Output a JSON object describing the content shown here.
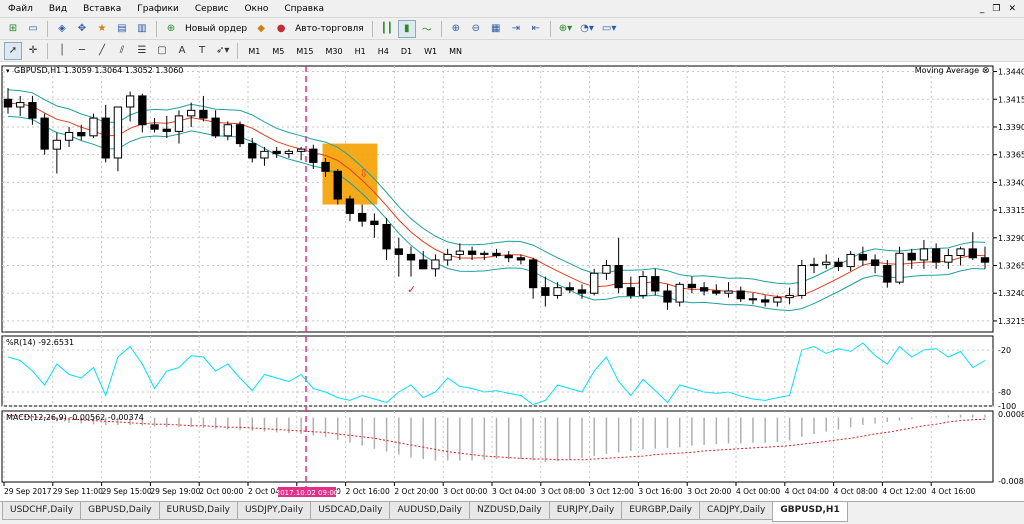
{
  "menu": [
    "Файл",
    "Вид",
    "Вставка",
    "Графики",
    "Сервис",
    "Окно",
    "Справка"
  ],
  "toolbar": {
    "new_order": "Новый ордер",
    "auto_trading": "Авто-торговля",
    "timeframes": [
      "M1",
      "M5",
      "M15",
      "M30",
      "H1",
      "H4",
      "D1",
      "W1",
      "MN"
    ],
    "active_timeframe": "H1"
  },
  "chart": {
    "header": "GBPUSD,H1  1.3059 1.3064 1.3052 1.3060",
    "indicator_label": "Moving Average",
    "price_ticks": [
      "1.3440",
      "1.3415",
      "1.3390",
      "1.3365",
      "1.3340",
      "1.3315",
      "1.3290",
      "1.3265",
      "1.3240",
      "1.3215"
    ],
    "wpr_label": "%R(14) -92.6531",
    "wpr_ticks": [
      "-20",
      "-80",
      "-100"
    ],
    "macd_label": "MACD(12,26,9) -0.00562 -0.00374",
    "macd_ticks": [
      "0.00089",
      "-0.00870"
    ],
    "time_ticks": [
      "29 Sep 2017",
      "29 Sep 11:00",
      "29 Sep 15:00",
      "29 Sep 19:00",
      "2 Oct 00:00",
      "2 Oct 04:00",
      "2 Oct 12:00",
      "2 Oct 16:00",
      "2 Oct 20:00",
      "3 Oct 00:00",
      "3 Oct 04:00",
      "3 Oct 08:00",
      "3 Oct 12:00",
      "3 Oct 16:00",
      "3 Oct 20:00",
      "4 Oct 00:00",
      "4 Oct 04:00",
      "4 Oct 08:00",
      "4 Oct 12:00",
      "4 Oct 16:00"
    ],
    "cursor_time": "2017.10.02 09:00",
    "colors": {
      "bull": "#ffffff",
      "bear": "#000000",
      "ma_channel": "#20a0a0",
      "ma_mid": "#e04020",
      "wpr": "#00e0ff",
      "macd_signal": "#e02020",
      "highlight": "#f5a000",
      "crosshair": "#e0308a"
    }
  },
  "chart_data": {
    "type": "candlestick",
    "symbol": "GBPUSD",
    "timeframe": "H1",
    "ylim": [
      1.3205,
      1.3445
    ],
    "candles": [
      [
        1.3415,
        1.3425,
        1.3402,
        1.3408
      ],
      [
        1.3408,
        1.3418,
        1.34,
        1.3412
      ],
      [
        1.3412,
        1.3418,
        1.3392,
        1.3398
      ],
      [
        1.3398,
        1.3402,
        1.3365,
        1.337
      ],
      [
        1.337,
        1.3385,
        1.3348,
        1.3378
      ],
      [
        1.3378,
        1.339,
        1.3372,
        1.3385
      ],
      [
        1.3385,
        1.3392,
        1.3378,
        1.3382
      ],
      [
        1.3382,
        1.3402,
        1.338,
        1.3398
      ],
      [
        1.3398,
        1.341,
        1.3358,
        1.3362
      ],
      [
        1.3362,
        1.3402,
        1.335,
        1.3408
      ],
      [
        1.3408,
        1.3422,
        1.3395,
        1.3418
      ],
      [
        1.3418,
        1.342,
        1.3385,
        1.3392
      ],
      [
        1.3392,
        1.3398,
        1.3385,
        1.3388
      ],
      [
        1.3388,
        1.34,
        1.338,
        1.3386
      ],
      [
        1.3386,
        1.3405,
        1.3375,
        1.34
      ],
      [
        1.34,
        1.3412,
        1.339,
        1.3405
      ],
      [
        1.3405,
        1.3418,
        1.3395,
        1.3398
      ],
      [
        1.3398,
        1.3405,
        1.338,
        1.3382
      ],
      [
        1.3382,
        1.3395,
        1.3378,
        1.3392
      ],
      [
        1.3392,
        1.3395,
        1.3372,
        1.3375
      ],
      [
        1.3375,
        1.338,
        1.3358,
        1.3362
      ],
      [
        1.3362,
        1.3372,
        1.3355,
        1.3368
      ],
      [
        1.3368,
        1.3372,
        1.3362,
        1.3366
      ],
      [
        1.3366,
        1.337,
        1.3362,
        1.3368
      ],
      [
        1.3368,
        1.3372,
        1.336,
        1.337
      ],
      [
        1.337,
        1.3374,
        1.3352,
        1.3358
      ],
      [
        1.3358,
        1.3362,
        1.3345,
        1.335
      ],
      [
        1.335,
        1.3352,
        1.332,
        1.3325
      ],
      [
        1.3325,
        1.3328,
        1.3305,
        1.3312
      ],
      [
        1.3312,
        1.332,
        1.33,
        1.3305
      ],
      [
        1.3305,
        1.3312,
        1.329,
        1.3302
      ],
      [
        1.3302,
        1.3308,
        1.327,
        1.328
      ],
      [
        1.328,
        1.329,
        1.3255,
        1.3275
      ],
      [
        1.3275,
        1.3282,
        1.3255,
        1.327
      ],
      [
        1.327,
        1.3278,
        1.3262,
        1.3262
      ],
      [
        1.3262,
        1.3275,
        1.3255,
        1.327
      ],
      [
        1.327,
        1.328,
        1.3265,
        1.3275
      ],
      [
        1.3275,
        1.3285,
        1.327,
        1.3278
      ],
      [
        1.3278,
        1.3282,
        1.327,
        1.3275
      ],
      [
        1.3275,
        1.3278,
        1.327,
        1.3276
      ],
      [
        1.3276,
        1.328,
        1.3272,
        1.3274
      ],
      [
        1.3274,
        1.3278,
        1.3268,
        1.3272
      ],
      [
        1.3272,
        1.3275,
        1.3266,
        1.327
      ],
      [
        1.327,
        1.3272,
        1.3235,
        1.3245
      ],
      [
        1.3245,
        1.3255,
        1.3228,
        1.3238
      ],
      [
        1.3238,
        1.325,
        1.3235,
        1.3245
      ],
      [
        1.3245,
        1.325,
        1.324,
        1.3243
      ],
      [
        1.3243,
        1.3248,
        1.3235,
        1.324
      ],
      [
        1.324,
        1.3262,
        1.3238,
        1.3258
      ],
      [
        1.3258,
        1.327,
        1.3252,
        1.3265
      ],
      [
        1.3265,
        1.329,
        1.324,
        1.3245
      ],
      [
        1.3245,
        1.3255,
        1.3235,
        1.3238
      ],
      [
        1.3238,
        1.326,
        1.3235,
        1.3255
      ],
      [
        1.3255,
        1.3262,
        1.3238,
        1.3242
      ],
      [
        1.3242,
        1.3248,
        1.3225,
        1.3232
      ],
      [
        1.3232,
        1.325,
        1.3228,
        1.3248
      ],
      [
        1.3248,
        1.3255,
        1.324,
        1.3245
      ],
      [
        1.3245,
        1.325,
        1.3238,
        1.3242
      ],
      [
        1.3242,
        1.3248,
        1.3238,
        1.324
      ],
      [
        1.324,
        1.325,
        1.3236,
        1.3242
      ],
      [
        1.3242,
        1.3246,
        1.3232,
        1.3235
      ],
      [
        1.3235,
        1.324,
        1.323,
        1.3234
      ],
      [
        1.3234,
        1.3238,
        1.3228,
        1.3232
      ],
      [
        1.3232,
        1.3238,
        1.3228,
        1.3236
      ],
      [
        1.3236,
        1.3245,
        1.323,
        1.3238
      ],
      [
        1.3238,
        1.327,
        1.3235,
        1.3265
      ],
      [
        1.3265,
        1.3272,
        1.3258,
        1.3266
      ],
      [
        1.3266,
        1.3275,
        1.3262,
        1.3268
      ],
      [
        1.3268,
        1.3272,
        1.326,
        1.3264
      ],
      [
        1.3264,
        1.3278,
        1.326,
        1.3275
      ],
      [
        1.3275,
        1.3282,
        1.3265,
        1.327
      ],
      [
        1.327,
        1.3275,
        1.3258,
        1.3265
      ],
      [
        1.3265,
        1.327,
        1.3245,
        1.325
      ],
      [
        1.325,
        1.3282,
        1.3248,
        1.3276
      ],
      [
        1.3276,
        1.328,
        1.3262,
        1.327
      ],
      [
        1.327,
        1.3288,
        1.3262,
        1.328
      ],
      [
        1.328,
        1.3285,
        1.3262,
        1.3268
      ],
      [
        1.3268,
        1.328,
        1.3262,
        1.3274
      ],
      [
        1.3274,
        1.3282,
        1.3265,
        1.328
      ],
      [
        1.328,
        1.3295,
        1.327,
        1.3272
      ],
      [
        1.3272,
        1.3282,
        1.3262,
        1.3268
      ]
    ],
    "wpr": [
      -30,
      -35,
      -50,
      -70,
      -40,
      -55,
      -60,
      -45,
      -85,
      -30,
      -15,
      -40,
      -75,
      -50,
      -45,
      -28,
      -30,
      -50,
      -40,
      -60,
      -78,
      -55,
      -60,
      -65,
      -55,
      -75,
      -80,
      -88,
      -92,
      -85,
      -90,
      -95,
      -80,
      -70,
      -88,
      -80,
      -60,
      -72,
      -75,
      -80,
      -78,
      -82,
      -85,
      -98,
      -92,
      -70,
      -75,
      -80,
      -50,
      -30,
      -65,
      -85,
      -62,
      -78,
      -95,
      -70,
      -75,
      -80,
      -82,
      -80,
      -86,
      -90,
      -92,
      -88,
      -85,
      -20,
      -15,
      -25,
      -18,
      -22,
      -10,
      -28,
      -40,
      -15,
      -30,
      -20,
      -18,
      -30,
      -22,
      -45,
      -35
    ],
    "macd_hist": [
      0.0,
      0.0,
      0.0,
      -0.0002,
      -0.0005,
      -0.0007,
      -0.0008,
      -0.0009,
      -0.001,
      -0.001,
      -0.001,
      -0.0011,
      -0.0012,
      -0.0013,
      -0.0013,
      -0.0013,
      -0.0014,
      -0.0015,
      -0.0016,
      -0.0017,
      -0.0018,
      -0.0019,
      -0.002,
      -0.0021,
      -0.0022,
      -0.0024,
      -0.0026,
      -0.003,
      -0.0034,
      -0.0038,
      -0.0042,
      -0.0046,
      -0.005,
      -0.0054,
      -0.0056,
      -0.0058,
      -0.0058,
      -0.0058,
      -0.0058,
      -0.0057,
      -0.0056,
      -0.0056,
      -0.0056,
      -0.0058,
      -0.006,
      -0.0059,
      -0.0057,
      -0.0055,
      -0.0052,
      -0.0049,
      -0.0047,
      -0.0045,
      -0.0043,
      -0.0042,
      -0.0041,
      -0.004,
      -0.0038,
      -0.0037,
      -0.0036,
      -0.0035,
      -0.0035,
      -0.0034,
      -0.0034,
      -0.0033,
      -0.0031,
      -0.0026,
      -0.0022,
      -0.0019,
      -0.0016,
      -0.0013,
      -0.001,
      -0.0008,
      -0.0006,
      -0.0004,
      -0.0002,
      0.0,
      0.0002,
      0.0003,
      0.0004,
      0.0004,
      0.0004
    ],
    "macd_signal": [
      0.0003,
      0.0002,
      0.0001,
      0.0,
      -0.0001,
      -0.0002,
      -0.0003,
      -0.0004,
      -0.0005,
      -0.0006,
      -0.0007,
      -0.0008,
      -0.0009,
      -0.0009,
      -0.001,
      -0.0011,
      -0.0011,
      -0.0012,
      -0.0013,
      -0.0013,
      -0.0014,
      -0.0015,
      -0.0016,
      -0.0017,
      -0.0018,
      -0.0019,
      -0.002,
      -0.0022,
      -0.0024,
      -0.0026,
      -0.0028,
      -0.0031,
      -0.0034,
      -0.0037,
      -0.004,
      -0.0043,
      -0.0046,
      -0.0048,
      -0.005,
      -0.0052,
      -0.0053,
      -0.0054,
      -0.0055,
      -0.0056,
      -0.0056,
      -0.0057,
      -0.0057,
      -0.0057,
      -0.0056,
      -0.0055,
      -0.0054,
      -0.0053,
      -0.0052,
      -0.005,
      -0.0049,
      -0.0048,
      -0.0047,
      -0.0045,
      -0.0044,
      -0.0043,
      -0.0042,
      -0.0041,
      -0.004,
      -0.0039,
      -0.0038,
      -0.0036,
      -0.0034,
      -0.0032,
      -0.003,
      -0.0028,
      -0.0025,
      -0.0022,
      -0.002,
      -0.0017,
      -0.0014,
      -0.0011,
      -0.0009,
      -0.0006,
      -0.0004,
      -0.0003,
      -0.0002
    ]
  },
  "tabs": [
    "USDCHF,Daily",
    "GBPUSD,Daily",
    "EURUSD,Daily",
    "USDJPY,Daily",
    "USDCAD,Daily",
    "AUDUSD,Daily",
    "NZDUSD,Daily",
    "EURJPY,Daily",
    "EURGBP,Daily",
    "CADJPY,Daily",
    "GBPUSD,H1"
  ],
  "active_tab": "GBPUSD,H1"
}
